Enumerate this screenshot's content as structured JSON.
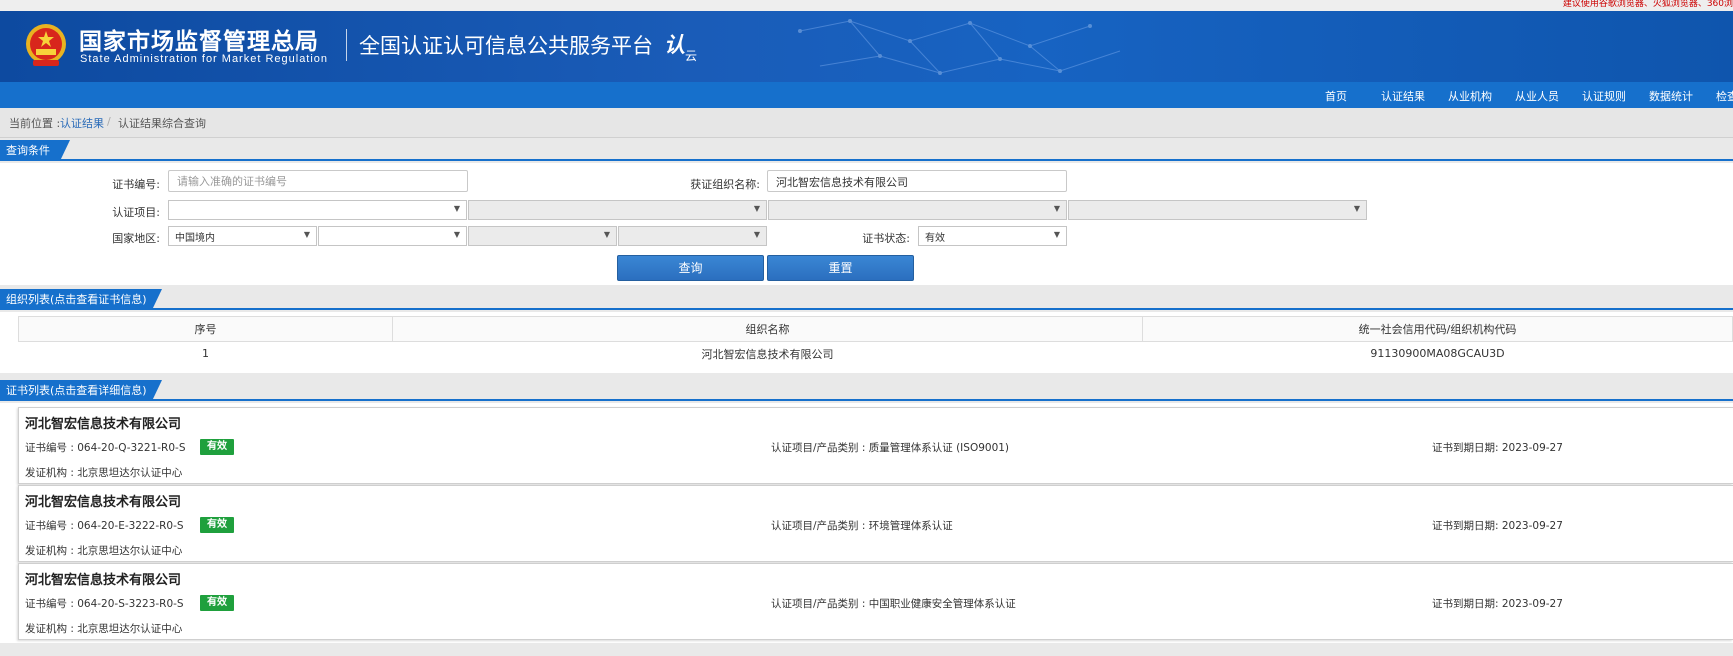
{
  "top_notice": "建议使用谷歌浏览器、火狐浏览器、360浏",
  "header": {
    "brand_cn": "国家市场监督管理总局",
    "brand_en": "State Administration for Market Regulation",
    "platform": "全国认证认可信息公共服务平台",
    "logo_text": "认",
    "logo_sub": "云"
  },
  "nav": [
    "首页",
    "认证结果",
    "从业机构",
    "从业人员",
    "认证规则",
    "数据统计",
    "检查"
  ],
  "breadcrumb": {
    "prefix": "当前位置 :",
    "link": "认证结果",
    "sep": "/",
    "current": "认证结果综合查询"
  },
  "query": {
    "section_title": "查询条件",
    "cert_no_label": "证书编号:",
    "cert_no_placeholder": "请输入准确的证书编号",
    "org_label": "获证组织名称:",
    "org_value": "河北智宏信息技术有限公司",
    "project_label": "认证项目:",
    "region_label": "国家地区:",
    "region_value": "中国境内",
    "status_label": "证书状态:",
    "status_value": "有效",
    "search_button": "查询",
    "reset_button": "重置"
  },
  "org_list": {
    "section_title": "组织列表(点击查看证书信息)",
    "columns": [
      "序号",
      "组织名称",
      "统一社会信用代码/组织机构代码"
    ],
    "rows": [
      [
        "1",
        "河北智宏信息技术有限公司",
        "91130900MA08GCAU3D"
      ]
    ]
  },
  "cert_list": {
    "section_title": "证书列表(点击查看详细信息)",
    "items": [
      {
        "org": "河北智宏信息技术有限公司",
        "cert_no": "证书编号 : 064-20-Q-3221-R0-S",
        "status": "有效",
        "project": "认证项目/产品类别 : 质量管理体系认证 (ISO9001)",
        "expiry": "证书到期日期: 2023-09-27",
        "issuer": "发证机构 : 北京思坦达尔认证中心"
      },
      {
        "org": "河北智宏信息技术有限公司",
        "cert_no": "证书编号 : 064-20-E-3222-R0-S",
        "status": "有效",
        "project": "认证项目/产品类别 : 环境管理体系认证",
        "expiry": "证书到期日期: 2023-09-27",
        "issuer": "发证机构 : 北京思坦达尔认证中心"
      },
      {
        "org": "河北智宏信息技术有限公司",
        "cert_no": "证书编号 : 064-20-S-3223-R0-S",
        "status": "有效",
        "project": "认证项目/产品类别 : 中国职业健康安全管理体系认证",
        "expiry": "证书到期日期: 2023-09-27",
        "issuer": "发证机构 : 北京思坦达尔认证中心"
      }
    ]
  },
  "colors": {
    "header_blue": "#0d4aa0",
    "nav_blue": "#1670cc",
    "valid_green": "#1fa03d"
  }
}
